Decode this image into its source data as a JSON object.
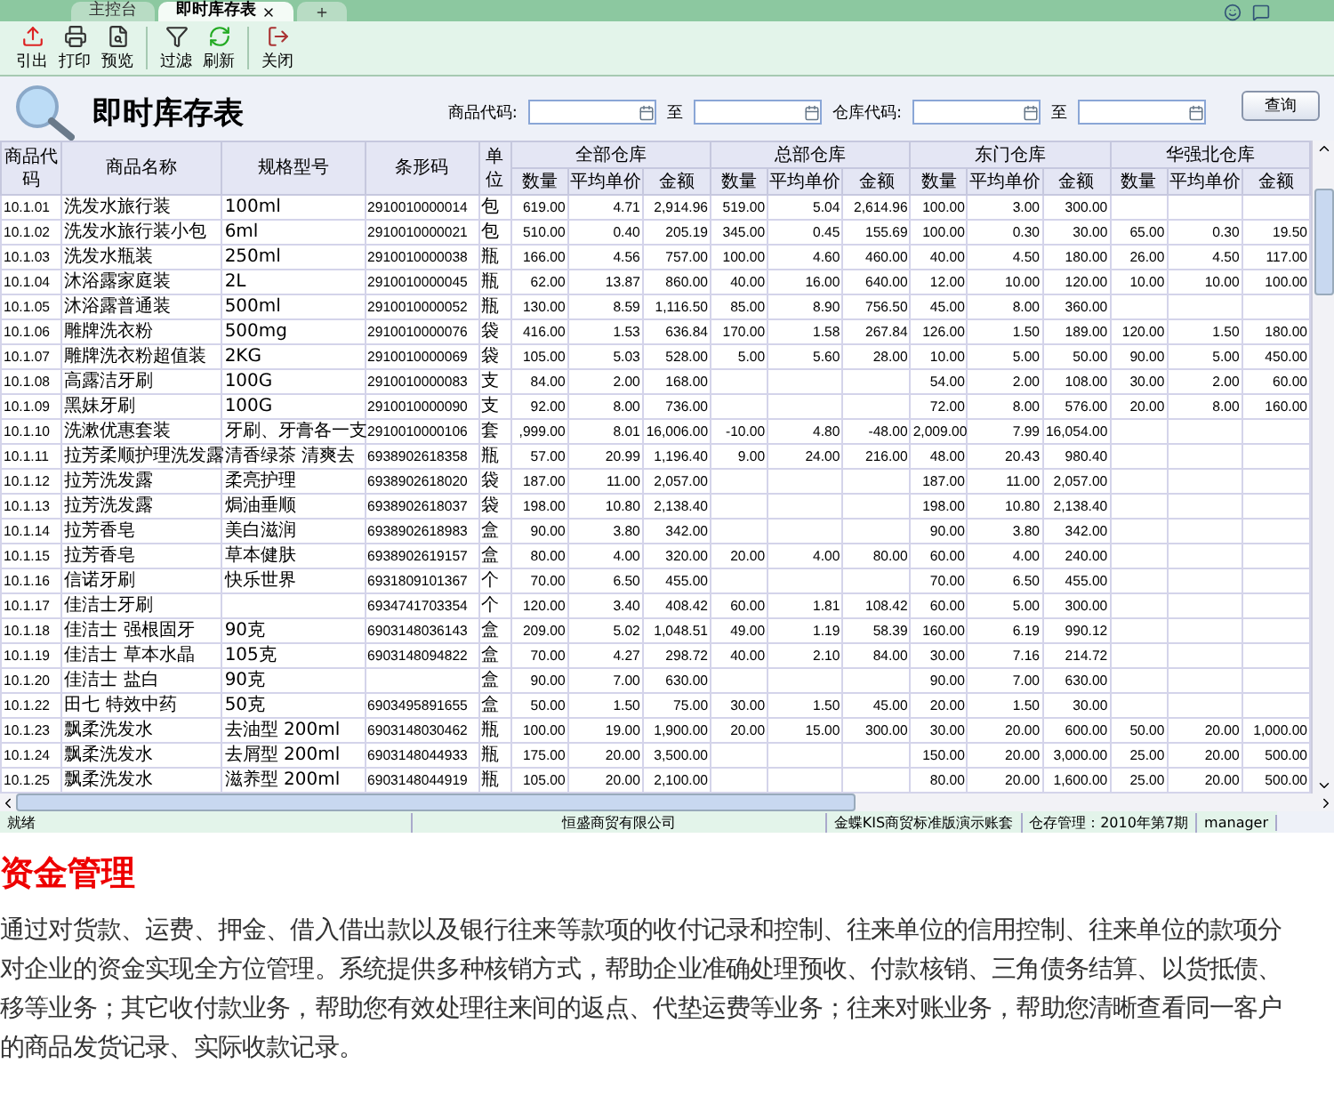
{
  "tabs": [
    {
      "label": "主控台",
      "selected": false,
      "closable": false
    },
    {
      "label": "即时库存表",
      "selected": true,
      "closable": true
    }
  ],
  "toolbar": [
    [
      {
        "label": "引出",
        "kind": "export"
      },
      {
        "label": "打印",
        "kind": "print"
      },
      {
        "label": "预览",
        "kind": "preview"
      }
    ],
    [
      {
        "label": "过滤",
        "kind": "filter"
      },
      {
        "label": "刷新",
        "kind": "refresh"
      }
    ],
    [
      {
        "label": "关闭",
        "kind": "close"
      }
    ]
  ],
  "report": {
    "title": "即时库存表",
    "filters": [
      {
        "label": "商品代码:",
        "to_label": "至"
      },
      {
        "label": "仓库代码:",
        "to_label": "至"
      }
    ],
    "query_button": "查询"
  },
  "table": {
    "columns": [
      "商品代码",
      "商品名称",
      "规格型号",
      "条形码",
      "单位"
    ],
    "warehouses": [
      {
        "kind": "all",
        "name": "全部仓库",
        "columns": [
          "数量",
          "平均单价",
          "金额"
        ]
      },
      {
        "kind": "hq",
        "name": "总部仓库",
        "columns": [
          "数量",
          "平均单价",
          "金额"
        ]
      },
      {
        "kind": "east",
        "name": "东门仓库",
        "columns": [
          "数量",
          "平均单价",
          "金额"
        ]
      },
      {
        "kind": "north",
        "name": "华强北仓库",
        "columns": [
          "数量",
          "平均单价",
          "金额"
        ]
      }
    ],
    "rows": [
      {
        "code": "10.1.01",
        "name": "洗发水旅行装",
        "spec": "100ml",
        "barcode": "2910010000014",
        "unit": "包",
        "all": [
          "619.00",
          "4.71",
          "2,914.96"
        ],
        "hq": [
          "519.00",
          "5.04",
          "2,614.96"
        ],
        "east": [
          "100.00",
          "3.00",
          "300.00"
        ]
      },
      {
        "code": "10.1.02",
        "name": "洗发水旅行装小包",
        "spec": "6ml",
        "barcode": "2910010000021",
        "unit": "包",
        "all": [
          "510.00",
          "0.40",
          "205.19"
        ],
        "hq": [
          "345.00",
          "0.45",
          "155.69"
        ],
        "east": [
          "100.00",
          "0.30",
          "30.00"
        ],
        "north": [
          "65.00",
          "0.30",
          "19.50"
        ]
      },
      {
        "code": "10.1.03",
        "name": "洗发水瓶装",
        "spec": "250ml",
        "barcode": "2910010000038",
        "unit": "瓶",
        "all": [
          "166.00",
          "4.56",
          "757.00"
        ],
        "hq": [
          "100.00",
          "4.60",
          "460.00"
        ],
        "east": [
          "40.00",
          "4.50",
          "180.00"
        ],
        "north": [
          "26.00",
          "4.50",
          "117.00"
        ]
      },
      {
        "code": "10.1.04",
        "name": "沐浴露家庭装",
        "spec": "2L",
        "barcode": "2910010000045",
        "unit": "瓶",
        "all": [
          "62.00",
          "13.87",
          "860.00"
        ],
        "hq": [
          "40.00",
          "16.00",
          "640.00"
        ],
        "east": [
          "12.00",
          "10.00",
          "120.00"
        ],
        "north": [
          "10.00",
          "10.00",
          "100.00"
        ]
      },
      {
        "code": "10.1.05",
        "name": "沐浴露普通装",
        "spec": "500ml",
        "barcode": "2910010000052",
        "unit": "瓶",
        "all": [
          "130.00",
          "8.59",
          "1,116.50"
        ],
        "hq": [
          "85.00",
          "8.90",
          "756.50"
        ],
        "east": [
          "45.00",
          "8.00",
          "360.00"
        ]
      },
      {
        "code": "10.1.06",
        "name": "雕牌洗衣粉",
        "spec": "500mg",
        "barcode": "2910010000076",
        "unit": "袋",
        "all": [
          "416.00",
          "1.53",
          "636.84"
        ],
        "hq": [
          "170.00",
          "1.58",
          "267.84"
        ],
        "east": [
          "126.00",
          "1.50",
          "189.00"
        ],
        "north": [
          "120.00",
          "1.50",
          "180.00"
        ]
      },
      {
        "code": "10.1.07",
        "name": "雕牌洗衣粉超值装",
        "spec": "2KG",
        "barcode": "2910010000069",
        "unit": "袋",
        "all": [
          "105.00",
          "5.03",
          "528.00"
        ],
        "hq": [
          "5.00",
          "5.60",
          "28.00"
        ],
        "east": [
          "10.00",
          "5.00",
          "50.00"
        ],
        "north": [
          "90.00",
          "5.00",
          "450.00"
        ]
      },
      {
        "code": "10.1.08",
        "name": "高露洁牙刷",
        "spec": "100G",
        "barcode": "2910010000083",
        "unit": "支",
        "all": [
          "84.00",
          "2.00",
          "168.00"
        ],
        "east": [
          "54.00",
          "2.00",
          "108.00"
        ],
        "north": [
          "30.00",
          "2.00",
          "60.00"
        ]
      },
      {
        "code": "10.1.09",
        "name": "黑妹牙刷",
        "spec": "100G",
        "barcode": "2910010000090",
        "unit": "支",
        "all": [
          "92.00",
          "8.00",
          "736.00"
        ],
        "east": [
          "72.00",
          "8.00",
          "576.00"
        ],
        "north": [
          "20.00",
          "8.00",
          "160.00"
        ]
      },
      {
        "code": "10.1.10",
        "name": "洗漱优惠套装",
        "spec": "牙刷、牙膏各一支",
        "barcode": "2910010000106",
        "unit": "套",
        "all": [
          ",999.00",
          "8.01",
          "16,006.00"
        ],
        "hq": [
          "-10.00",
          "4.80",
          "-48.00"
        ],
        "east": [
          "2,009.00",
          "7.99",
          "16,054.00"
        ]
      },
      {
        "code": "10.1.11",
        "name": "拉芳柔顺护理洗发露",
        "spec": "清香绿茶 清爽去",
        "barcode": "6938902618358",
        "unit": "瓶",
        "all": [
          "57.00",
          "20.99",
          "1,196.40"
        ],
        "hq": [
          "9.00",
          "24.00",
          "216.00"
        ],
        "east": [
          "48.00",
          "20.43",
          "980.40"
        ]
      },
      {
        "code": "10.1.12",
        "name": "拉芳洗发露",
        "spec": "柔亮护理",
        "barcode": "6938902618020",
        "unit": "袋",
        "all": [
          "187.00",
          "11.00",
          "2,057.00"
        ],
        "east": [
          "187.00",
          "11.00",
          "2,057.00"
        ]
      },
      {
        "code": "10.1.13",
        "name": "拉芳洗发露",
        "spec": "焗油垂顺",
        "barcode": "6938902618037",
        "unit": "袋",
        "all": [
          "198.00",
          "10.80",
          "2,138.40"
        ],
        "east": [
          "198.00",
          "10.80",
          "2,138.40"
        ]
      },
      {
        "code": "10.1.14",
        "name": "拉芳香皂",
        "spec": "美白滋润",
        "barcode": "6938902618983",
        "unit": "盒",
        "all": [
          "90.00",
          "3.80",
          "342.00"
        ],
        "east": [
          "90.00",
          "3.80",
          "342.00"
        ]
      },
      {
        "code": "10.1.15",
        "name": "拉芳香皂",
        "spec": "草本健肤",
        "barcode": "6938902619157",
        "unit": "盒",
        "all": [
          "80.00",
          "4.00",
          "320.00"
        ],
        "hq": [
          "20.00",
          "4.00",
          "80.00"
        ],
        "east": [
          "60.00",
          "4.00",
          "240.00"
        ]
      },
      {
        "code": "10.1.16",
        "name": "信诺牙刷",
        "spec": "快乐世界",
        "barcode": "6931809101367",
        "unit": "个",
        "all": [
          "70.00",
          "6.50",
          "455.00"
        ],
        "east": [
          "70.00",
          "6.50",
          "455.00"
        ]
      },
      {
        "code": "10.1.17",
        "name": "佳洁士牙刷",
        "barcode": "6934741703354",
        "unit": "个",
        "all": [
          "120.00",
          "3.40",
          "408.42"
        ],
        "hq": [
          "60.00",
          "1.81",
          "108.42"
        ],
        "east": [
          "60.00",
          "5.00",
          "300.00"
        ]
      },
      {
        "code": "10.1.18",
        "name": "佳洁士 强根固牙",
        "spec": "90克",
        "barcode": "6903148036143",
        "unit": "盒",
        "all": [
          "209.00",
          "5.02",
          "1,048.51"
        ],
        "hq": [
          "49.00",
          "1.19",
          "58.39"
        ],
        "east": [
          "160.00",
          "6.19",
          "990.12"
        ]
      },
      {
        "code": "10.1.19",
        "name": "佳洁士 草本水晶",
        "spec": "105克",
        "barcode": "6903148094822",
        "unit": "盒",
        "all": [
          "70.00",
          "4.27",
          "298.72"
        ],
        "hq": [
          "40.00",
          "2.10",
          "84.00"
        ],
        "east": [
          "30.00",
          "7.16",
          "214.72"
        ]
      },
      {
        "code": "10.1.20",
        "name": "佳洁士 盐白",
        "spec": "90克",
        "unit": "盒",
        "all": [
          "90.00",
          "7.00",
          "630.00"
        ],
        "east": [
          "90.00",
          "7.00",
          "630.00"
        ]
      },
      {
        "code": "10.1.22",
        "name": "田七 特效中药",
        "spec": "50克",
        "barcode": "6903495891655",
        "unit": "盒",
        "all": [
          "50.00",
          "1.50",
          "75.00"
        ],
        "hq": [
          "30.00",
          "1.50",
          "45.00"
        ],
        "east": [
          "20.00",
          "1.50",
          "30.00"
        ]
      },
      {
        "code": "10.1.23",
        "name": "飘柔洗发水",
        "spec": "去油型 200ml",
        "barcode": "6903148030462",
        "unit": "瓶",
        "all": [
          "100.00",
          "19.00",
          "1,900.00"
        ],
        "hq": [
          "20.00",
          "15.00",
          "300.00"
        ],
        "east": [
          "30.00",
          "20.00",
          "600.00"
        ],
        "north": [
          "50.00",
          "20.00",
          "1,000.00"
        ]
      },
      {
        "code": "10.1.24",
        "name": "飘柔洗发水",
        "spec": "去屑型 200ml",
        "barcode": "6903148044933",
        "unit": "瓶",
        "all": [
          "175.00",
          "20.00",
          "3,500.00"
        ],
        "east": [
          "150.00",
          "20.00",
          "3,000.00"
        ],
        "north": [
          "25.00",
          "20.00",
          "500.00"
        ]
      },
      {
        "code": "10.1.25",
        "name": "飘柔洗发水",
        "spec": "滋养型 200ml",
        "barcode": "6903148044919",
        "unit": "瓶",
        "all": [
          "105.00",
          "20.00",
          "2,100.00"
        ],
        "east": [
          "80.00",
          "20.00",
          "1,600.00"
        ],
        "north": [
          "25.00",
          "20.00",
          "500.00"
        ]
      }
    ]
  },
  "status_bar": [
    "就绪",
    "恒盛商贸有限公司",
    "金蝶KIS商贸标准版演示账套",
    "仓存管理：2010年第7期",
    "manager"
  ],
  "article": {
    "heading": "资金管理",
    "lines": [
      "通过对货款、运费、押金、借入借出款以及银行往来等款项的收付记录和控制、往来单位的信用控制、往来单位的款项分",
      "对企业的资金实现全方位管理。系统提供多种核销方式，帮助企业准确处理预收、付款核销、三角债务结算、以货抵债、",
      "移等业务；其它收付款业务，帮助您有效处理往来间的返点、代垫运费等业务；往来对账业务，帮助您清晰查看同一客户",
      "的商品发货记录、实际收款记录。"
    ]
  }
}
